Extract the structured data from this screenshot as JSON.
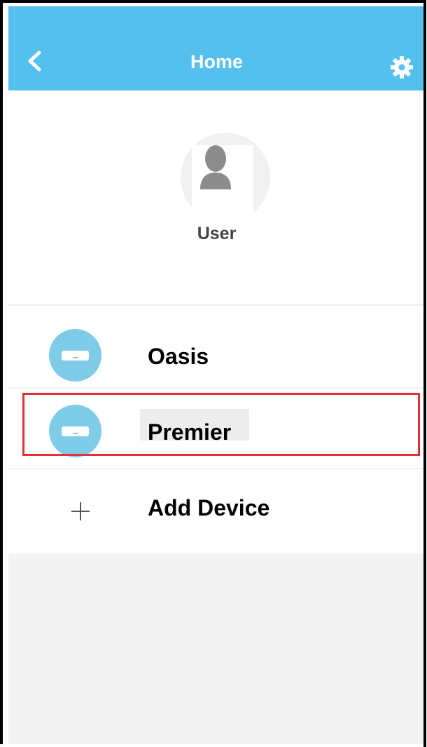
{
  "header": {
    "title": "Home",
    "back_icon": "chevron-left-icon",
    "settings_icon": "gear-icon",
    "background": "#55BFEE"
  },
  "profile": {
    "avatar_icon": "user-silhouette-icon",
    "name": "User"
  },
  "devices": [
    {
      "name": "Oasis",
      "icon": "air-conditioner-icon",
      "selected": false
    },
    {
      "name": "Premier",
      "icon": "air-conditioner-icon",
      "selected": true
    }
  ],
  "add_device": {
    "label": "Add Device",
    "icon": "plus-icon"
  },
  "colors": {
    "device_icon": "#7FCCE9",
    "highlight": "#E0303A"
  }
}
